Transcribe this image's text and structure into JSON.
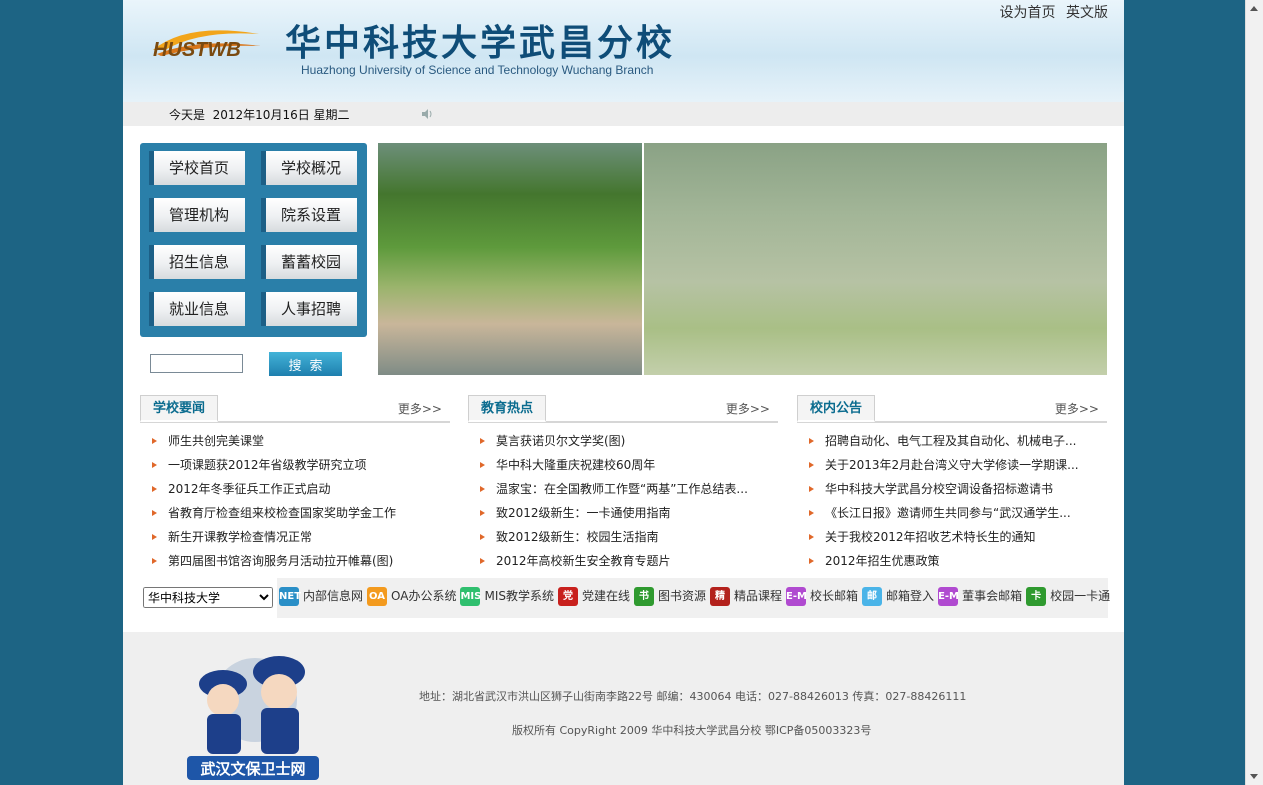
{
  "header": {
    "title_cn": "华中科技大学武昌分校",
    "title_en": "Huazhong University of Science and Technology Wuchang Branch",
    "logo_text": "HUSTWB",
    "links": [
      "设为首页",
      "英文版"
    ]
  },
  "datebar": {
    "text": "今天是  2012年10月16日 星期二"
  },
  "nav": [
    "学校首页",
    "学校概况",
    "管理机构",
    "院系设置",
    "招生信息",
    "蓄蓄校园",
    "就业信息",
    "人事招聘"
  ],
  "search": {
    "value": "",
    "button": "搜索"
  },
  "news": [
    {
      "title": "学校要闻",
      "more": "更多>>",
      "items": [
        "师生共创完美课堂",
        "一项课题获2012年省级教学研究立项",
        "2012年冬季征兵工作正式启动",
        "省教育厅检查组来校检查国家奖助学金工作",
        "新生开课教学检查情况正常",
        "第四届图书馆咨询服务月活动拉开帷幕(图)"
      ]
    },
    {
      "title": "教育热点",
      "more": "更多>>",
      "items": [
        "莫言获诺贝尔文学奖(图)",
        "华中科大隆重庆祝建校60周年",
        "温家宝：在全国教师工作暨“两基”工作总结表...",
        "致2012级新生：一卡通使用指南",
        "致2012级新生：校园生活指南",
        "2012年高校新生安全教育专题片"
      ]
    },
    {
      "title": "校内公告",
      "more": "更多>>",
      "items": [
        "招聘自动化、电气工程及其自动化、机械电子...",
        "关于2013年2月赴台湾义守大学修读一学期课...",
        "华中科技大学武昌分校空调设备招标邀请书",
        "《长江日报》邀请师生共同参与“武汉通学生...",
        "关于我校2012年招收艺术特长生的通知",
        "2012年招生优惠政策"
      ]
    }
  ],
  "select": {
    "selected": "华中科技大学"
  },
  "links": [
    {
      "icon": "NET",
      "label": "内部信息网",
      "color": "#2a8fc7",
      "icon_name": "net-icon"
    },
    {
      "icon": "OA",
      "label": "OA办公系统",
      "color": "#f39a1e",
      "icon_name": "oa-icon"
    },
    {
      "icon": "MIS",
      "label": "MIS教学系统",
      "color": "#2fbf6e",
      "icon_name": "mis-icon"
    },
    {
      "icon": "党",
      "label": "党建在线",
      "color": "#c8201d",
      "icon_name": "party-icon"
    },
    {
      "icon": "书",
      "label": "图书资源",
      "color": "#2f9a2f",
      "icon_name": "book-icon"
    },
    {
      "icon": "精",
      "label": "精品课程",
      "color": "#b3211c",
      "icon_name": "course-icon"
    },
    {
      "icon": "E-M",
      "label": "校长邮箱",
      "color": "#b04ad0",
      "icon_name": "email-icon"
    },
    {
      "icon": "邮",
      "label": "邮箱登入",
      "color": "#4ab4e8",
      "icon_name": "mail-login-icon"
    },
    {
      "icon": "E-M",
      "label": "董事会邮箱",
      "color": "#b04ad0",
      "icon_name": "board-email-icon"
    },
    {
      "icon": "卡",
      "label": "校园一卡通",
      "color": "#2f9a2f",
      "icon_name": "card-icon"
    }
  ],
  "footer": {
    "address": "地址：湖北省武汉市洪山区狮子山街南李路22号 邮编：430064 电话：027-88426013 传真：027-88426111",
    "copyright": "版权所有 CopyRight 2009 华中科技大学武昌分校 鄂ICP备05003323号",
    "mascot_caption": "武汉文保卫士网"
  },
  "colors": {
    "background": "#1d6484",
    "nav": "#2a7fa9",
    "accent": "#0b6c8f"
  }
}
